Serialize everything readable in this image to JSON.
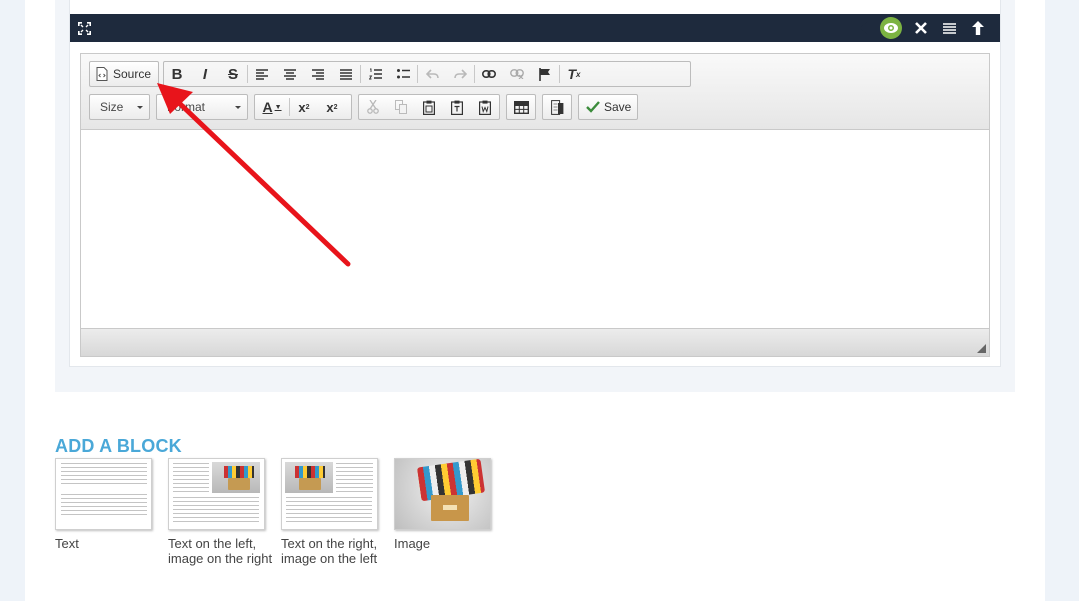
{
  "editor": {
    "source_label": "Source",
    "size_label": "Size",
    "format_label": "Format",
    "save_label": "Save"
  },
  "add_block": {
    "title": "ADD A BLOCK",
    "items": [
      {
        "label": "Text"
      },
      {
        "label": "Text on the left, image on the right"
      },
      {
        "label": "Text on the right, image on the left"
      },
      {
        "label": "Image"
      }
    ]
  },
  "colors": {
    "bar": "#1e2a3d",
    "accent": "#4aa8d8",
    "eye": "#7cb342",
    "arrow": "#e8141b"
  }
}
